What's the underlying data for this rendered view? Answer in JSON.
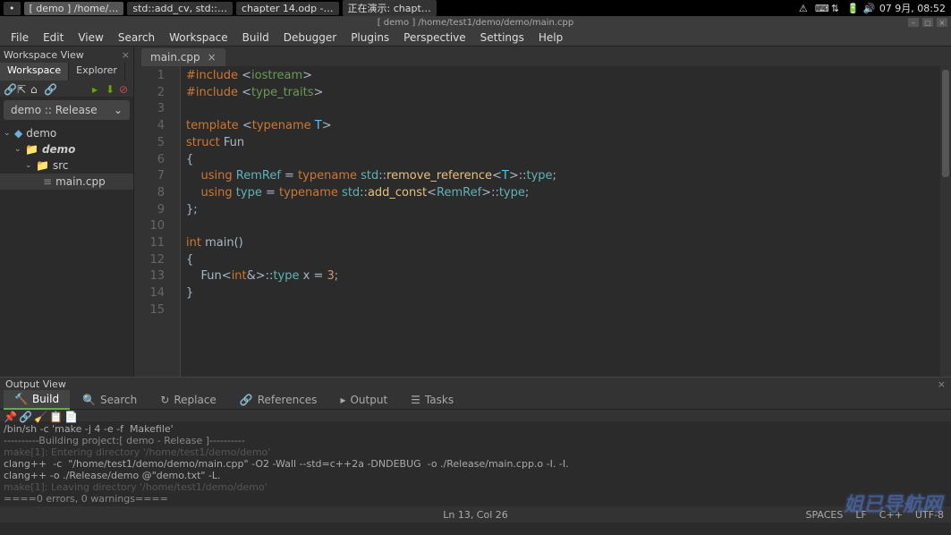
{
  "taskbar": {
    "items": [
      {
        "label": "•",
        "icon": "firefox"
      },
      {
        "label": "[ demo ] /home/…",
        "active": true
      },
      {
        "label": "std::add_cv, std::…",
        "icon": "firefox"
      },
      {
        "label": "chapter 14.odp -…",
        "icon": "impress"
      },
      {
        "label": "正在演示: chapt…",
        "icon": "impress"
      }
    ],
    "clock": "07 9月, 08:52"
  },
  "titlebar": "[ demo ] /home/test1/demo/demo/main.cpp",
  "menubar": [
    "File",
    "Edit",
    "View",
    "Search",
    "Workspace",
    "Build",
    "Debugger",
    "Plugins",
    "Perspective",
    "Settings",
    "Help"
  ],
  "workspace": {
    "panel_title": "Workspace View",
    "tabs": [
      "Workspace",
      "Explorer"
    ],
    "active_tab": 0,
    "config": "demo :: Release",
    "tree": {
      "root": "demo",
      "project": "demo",
      "folder": "src",
      "file": "main.cpp"
    }
  },
  "editor": {
    "tab_name": "main.cpp",
    "lines": [
      {
        "n": 1,
        "tokens": [
          [
            "#include ",
            "kw"
          ],
          [
            "<",
            "punc"
          ],
          [
            "iostream",
            "gn"
          ],
          [
            ">",
            "punc"
          ]
        ]
      },
      {
        "n": 2,
        "tokens": [
          [
            "#include ",
            "kw"
          ],
          [
            "<",
            "punc"
          ],
          [
            "type_traits",
            "gn"
          ],
          [
            ">",
            "punc"
          ]
        ]
      },
      {
        "n": 3,
        "tokens": [
          [
            "",
            ""
          ]
        ]
      },
      {
        "n": 4,
        "tokens": [
          [
            "template ",
            "kw"
          ],
          [
            "<",
            "punc"
          ],
          [
            "typename ",
            "kw"
          ],
          [
            "T",
            "tname"
          ],
          [
            ">",
            "punc"
          ]
        ]
      },
      {
        "n": 5,
        "tokens": [
          [
            "struct ",
            "kw"
          ],
          [
            "Fun",
            "cls"
          ]
        ]
      },
      {
        "n": 6,
        "tokens": [
          [
            "{",
            "punc"
          ]
        ]
      },
      {
        "n": 7,
        "tokens": [
          [
            "    using ",
            "kw"
          ],
          [
            "RemRef",
            "type"
          ],
          [
            " = ",
            "punc"
          ],
          [
            "typename ",
            "kw"
          ],
          [
            "std",
            "type"
          ],
          [
            "::",
            "punc"
          ],
          [
            "remove_reference",
            "fn"
          ],
          [
            "<",
            "punc"
          ],
          [
            "T",
            "tname"
          ],
          [
            ">::",
            "punc"
          ],
          [
            "type",
            "type"
          ],
          [
            ";",
            "punc"
          ]
        ]
      },
      {
        "n": 8,
        "tokens": [
          [
            "    using ",
            "kw"
          ],
          [
            "type",
            "type"
          ],
          [
            " = ",
            "punc"
          ],
          [
            "typename ",
            "kw"
          ],
          [
            "std",
            "type"
          ],
          [
            "::",
            "punc"
          ],
          [
            "add_const",
            "fn"
          ],
          [
            "<",
            "punc"
          ],
          [
            "RemRef",
            "type"
          ],
          [
            ">::",
            "punc"
          ],
          [
            "type",
            "type"
          ],
          [
            ";",
            "punc"
          ]
        ]
      },
      {
        "n": 9,
        "tokens": [
          [
            "};",
            "punc"
          ]
        ]
      },
      {
        "n": 10,
        "tokens": [
          [
            "",
            ""
          ]
        ]
      },
      {
        "n": 11,
        "tokens": [
          [
            "int ",
            "kw"
          ],
          [
            "main",
            "cls"
          ],
          [
            "()",
            "punc"
          ]
        ]
      },
      {
        "n": 12,
        "tokens": [
          [
            "{",
            "punc"
          ]
        ]
      },
      {
        "n": 13,
        "tokens": [
          [
            "    Fun",
            "cls"
          ],
          [
            "<",
            "punc"
          ],
          [
            "int",
            "kw"
          ],
          [
            "&>::",
            "punc"
          ],
          [
            "type",
            "type"
          ],
          [
            " x = ",
            "punc"
          ],
          [
            "3",
            "num"
          ],
          [
            ";",
            "punc"
          ]
        ]
      },
      {
        "n": 14,
        "tokens": [
          [
            "}",
            "punc"
          ]
        ]
      },
      {
        "n": 15,
        "tokens": [
          [
            "",
            ""
          ]
        ]
      }
    ]
  },
  "output": {
    "title": "Output View",
    "tabs": [
      "Build",
      "Search",
      "Replace",
      "References",
      "Output",
      "Tasks"
    ],
    "active_tab": 0,
    "lines": [
      "/bin/sh -c 'make -j 4 -e -f  Makefile'",
      "----------Building project:[ demo - Release ]----------",
      "make[1]: Entering directory '/home/test1/demo/demo'",
      "clang++  -c  \"/home/test1/demo/demo/main.cpp\" -O2 -Wall --std=c++2a -DNDEBUG  -o ./Release/main.cpp.o -I. -I.",
      "clang++ -o ./Release/demo @\"demo.txt\" -L.",
      "make[1]: Leaving directory '/home/test1/demo/demo'",
      "====0 errors, 0 warnings===="
    ]
  },
  "statusbar": {
    "position": "Ln 13, Col 26",
    "items": [
      "SPACES",
      "LF",
      "C++",
      "UTF-8"
    ]
  },
  "watermark": "姐已导航网"
}
